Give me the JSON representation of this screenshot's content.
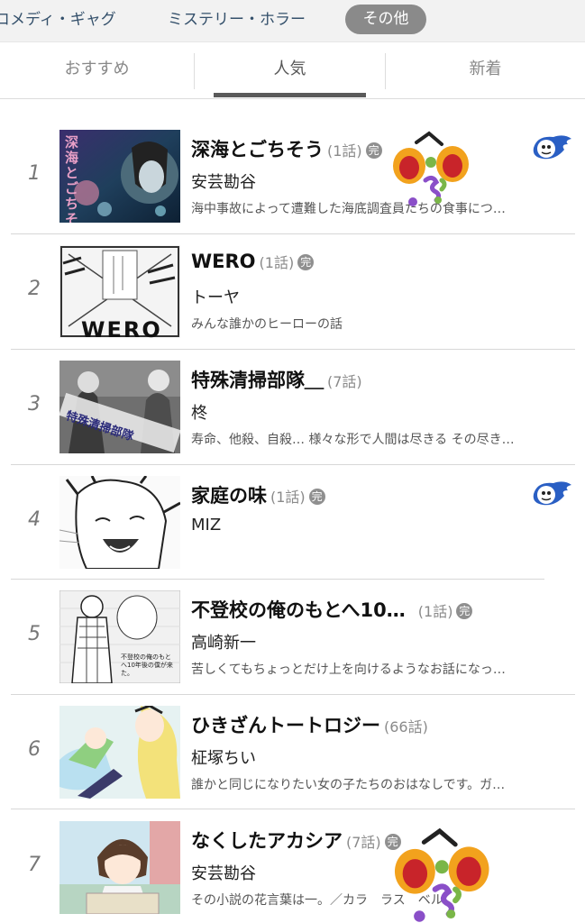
{
  "genres": [
    "コメディ・ギャグ",
    "ミステリー・ホラー",
    "その他"
  ],
  "tabs": [
    {
      "label": "おすすめ",
      "active": false
    },
    {
      "label": "人気",
      "active": true
    },
    {
      "label": "新着",
      "active": false
    }
  ],
  "rankings": [
    {
      "rank": "1",
      "title": "深海とごちそう",
      "episodes": "(1話)",
      "complete": "完",
      "author": "安芸勘谷",
      "desc": "海中事故によって遭難した海底調査員たちの食事につ…",
      "badge": true,
      "thumb_text": "深海とごちそう"
    },
    {
      "rank": "2",
      "title": "WERO",
      "episodes": "(1話)",
      "complete": "完",
      "author": "トーヤ",
      "desc": "みんな誰かのヒーローの話",
      "badge": false,
      "thumb_text": "WERO"
    },
    {
      "rank": "3",
      "title": "特殊清掃部隊＿",
      "episodes": "(7話)",
      "complete": "",
      "author": "柊",
      "desc": "寿命、他殺、自殺… 様々な形で人間は尽きる その尽き…",
      "badge": false,
      "thumb_text": "特殊清掃部隊"
    },
    {
      "rank": "4",
      "title": "家庭の味",
      "episodes": "(1話)",
      "complete": "完",
      "author": "MIZ",
      "desc": "",
      "badge": true,
      "thumb_text": ""
    },
    {
      "rank": "5",
      "title": "不登校の俺のもとへ10…",
      "episodes": "(1話)",
      "complete": "完",
      "author": "高崎新一",
      "desc": "苦しくてもちょっとだけ上を向けるようなお話になっ…",
      "badge": false,
      "thumb_text": "不登校の俺のもとへ10年後の僕が来た。"
    },
    {
      "rank": "6",
      "title": "ひきざんトートロジー",
      "episodes": "(66話)",
      "complete": "",
      "author": "柾塚ちい",
      "desc": "誰かと同じになりたい女の子たちのおはなしです。ガ…",
      "badge": false,
      "thumb_text": ""
    },
    {
      "rank": "7",
      "title": "なくしたアカシア",
      "episodes": "(7話)",
      "complete": "完",
      "author": "安芸勘谷",
      "desc": "その小説の花言葉は一。／カラ　ラス　ベル",
      "badge": false,
      "thumb_text": ""
    }
  ],
  "colors": {
    "accent": "#5a5a5a",
    "genre_text": "#34506b",
    "badge_blue": "#2a5fc4"
  }
}
